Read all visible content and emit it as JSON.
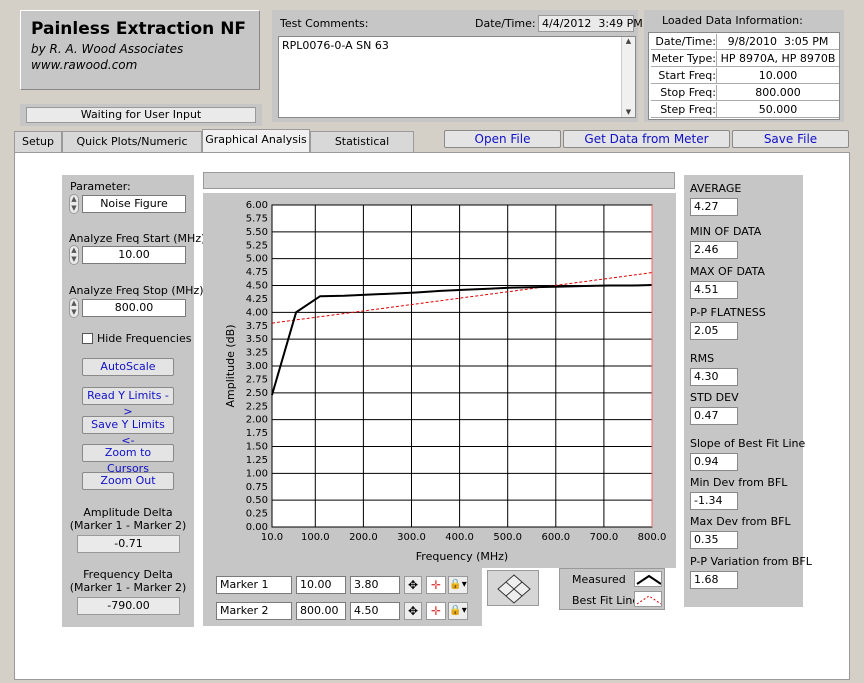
{
  "app": {
    "title": "Painless Extraction NF",
    "author": "by R. A. Wood Associates",
    "website": "www.rawood.com",
    "status": "Waiting for User Input"
  },
  "comments": {
    "label": "Test Comments:",
    "datetime_label": "Date/Time:",
    "datetime": "4/4/2012  3:49 PM",
    "text": "RPL0076-0-A SN 63"
  },
  "loaded": {
    "title": "Loaded Data Information:",
    "rows": [
      {
        "label": "Date/Time:",
        "value": "9/8/2010  3:05 PM"
      },
      {
        "label": "Meter Type:",
        "value": "HP 8970A, HP 8970B"
      },
      {
        "label": "Start Freq:",
        "value": "10.000"
      },
      {
        "label": "Stop Freq:",
        "value": "800.000"
      },
      {
        "label": "Step Freq:",
        "value": "50.000"
      }
    ]
  },
  "tabs": [
    "Setup",
    "Quick Plots/Numeric Data",
    "Graphical Analysis",
    "Statistical Analysis"
  ],
  "toolbar": {
    "open": "Open File",
    "get": "Get Data from Meter",
    "save": "Save File"
  },
  "left": {
    "parameter_label": "Parameter:",
    "parameter": "Noise Figure",
    "start_label": "Analyze Freq Start (MHz)",
    "start": "10.00",
    "stop_label": "Analyze Freq Stop (MHz)",
    "stop": "800.00",
    "hide_label": "Hide Frequencies",
    "buttons": [
      "AutoScale",
      "Read Y Limits ->",
      "Save Y Limits <-",
      "Zoom to Cursors",
      "Zoom Out"
    ],
    "amp_delta_label1": "Amplitude Delta",
    "amp_delta_label2": "(Marker 1 - Marker 2)",
    "amp_delta": "-0.71",
    "freq_delta_label1": "Frequency Delta",
    "freq_delta_label2": "(Marker 1 - Marker 2)",
    "freq_delta": "-790.00"
  },
  "markers": [
    {
      "name": "Marker 1",
      "x": "10.00",
      "y": "3.80"
    },
    {
      "name": "Marker 2",
      "x": "800.00",
      "y": "4.50"
    }
  ],
  "legend": {
    "measured": "Measured",
    "bestfit": "Best Fit Line"
  },
  "stats": [
    {
      "label": "AVERAGE",
      "value": "4.27"
    },
    {
      "label": "MIN OF DATA",
      "value": "2.46"
    },
    {
      "label": "MAX OF DATA",
      "value": "4.51"
    },
    {
      "label": "P-P FLATNESS",
      "value": "2.05"
    },
    {
      "label": "RMS",
      "value": "4.30"
    },
    {
      "label": "STD DEV",
      "value": "0.47"
    },
    {
      "label": "Slope of Best Fit Line",
      "value": "0.94"
    },
    {
      "label": "Min Dev from BFL",
      "value": "-1.34"
    },
    {
      "label": "Max Dev from BFL",
      "value": "0.35"
    },
    {
      "label": "P-P Variation from BFL",
      "value": "1.68"
    }
  ],
  "colors": {
    "measured": "#000000",
    "bestfit": "#e00000",
    "grid": "#000000"
  },
  "chart_data": {
    "type": "line",
    "xlabel": "Frequency (MHz)",
    "ylabel": "Amplitude (dB)",
    "xlim": [
      10,
      800
    ],
    "ylim": [
      0,
      6
    ],
    "x_ticks": [
      "10.0",
      "100.0",
      "200.0",
      "300.0",
      "400.0",
      "500.0",
      "600.0",
      "700.0",
      "800.0"
    ],
    "y_ticks": [
      "0.00",
      "0.25",
      "0.50",
      "0.75",
      "1.00",
      "1.25",
      "1.50",
      "1.75",
      "2.00",
      "2.25",
      "2.50",
      "2.75",
      "3.00",
      "3.25",
      "3.50",
      "3.75",
      "4.00",
      "4.25",
      "4.50",
      "4.75",
      "5.00",
      "5.25",
      "5.50",
      "5.75",
      "6.00"
    ],
    "grid": true,
    "series": [
      {
        "name": "Measured",
        "x": [
          10,
          60,
          110,
          160,
          210,
          260,
          310,
          360,
          410,
          460,
          510,
          560,
          610,
          660,
          710,
          760,
          800
        ],
        "y": [
          2.46,
          4.0,
          4.3,
          4.31,
          4.33,
          4.35,
          4.37,
          4.4,
          4.42,
          4.44,
          4.46,
          4.47,
          4.48,
          4.49,
          4.5,
          4.5,
          4.51
        ]
      },
      {
        "name": "Best Fit Line",
        "x": [
          10,
          800
        ],
        "y": [
          3.8,
          4.74
        ]
      }
    ]
  }
}
